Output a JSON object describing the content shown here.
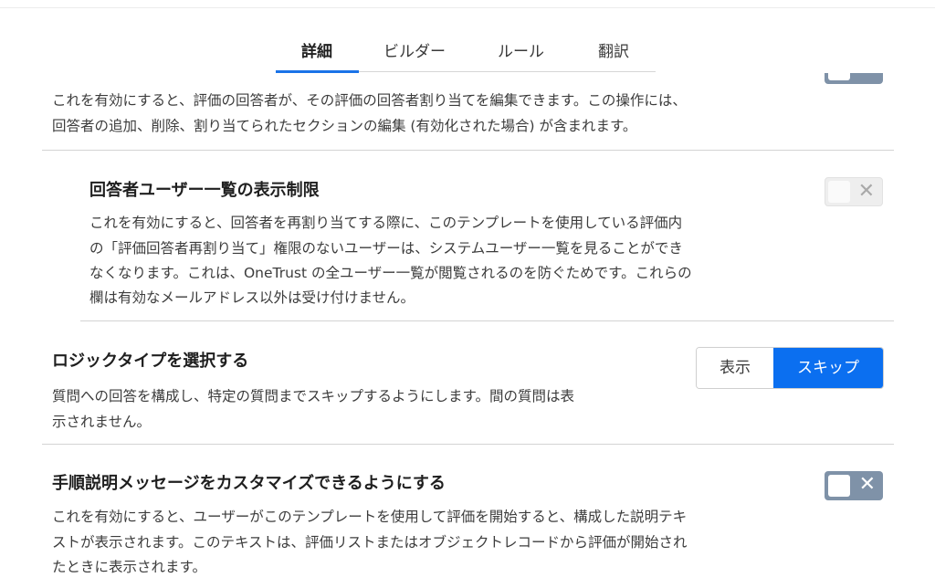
{
  "tabs": [
    {
      "label": "詳細",
      "active": true
    },
    {
      "label": "ビルダー",
      "active": false
    },
    {
      "label": "ルール",
      "active": false
    },
    {
      "label": "翻訳",
      "active": false
    }
  ],
  "sections": {
    "edit_respondents": {
      "description_line1": "これを有効にすると、評価の回答者が、その評価の回答者割り当てを編集できます。この操作には、",
      "description_line2": "回答者の追加、削除、割り当てられたセクションの編集 (有効化された場合) が含まれます。",
      "toggle_state": "off"
    },
    "restrict_user_list": {
      "title": "回答者ユーザー一覧の表示制限",
      "description_line1": "これを有効にすると、回答者を再割り当てする際に、このテンプレートを使用している評価内",
      "description_line2": "の「評価回答者再割り当て」権限のないユーザーは、システムユーザー一覧を見ることができ",
      "description_line3": "なくなります。これは、OneTrust の全ユーザー一覧が閲覧されるのを防ぐためです。これらの",
      "description_line4": "欄は有効なメールアドレス以外は受け付けません。",
      "toggle_state": "off-disabled"
    },
    "logic_type": {
      "title": "ロジックタイプを選択する",
      "description_line1": "質問への回答を構成し、特定の質問までスキップするようにします。間の質問は表",
      "description_line2": "示されません。",
      "options": [
        "表示",
        "スキップ"
      ],
      "selected": "スキップ"
    },
    "custom_instructions": {
      "title": "手順説明メッセージをカスタマイズできるようにする",
      "description_line1": "これを有効にすると、ユーザーがこのテンプレートを使用して評価を開始すると、構成した説明テキ",
      "description_line2": "ストが表示されます。このテキストは、評価リストまたはオブジェクトレコードから評価が開始され",
      "description_line3": "たときに表示されます。",
      "toggle_state": "off"
    }
  },
  "icons": {
    "toggle_off": "close-icon"
  },
  "colors": {
    "accent": "#1a73e8",
    "selected_segment": "#0b6ff0",
    "toggle_off": "#7f92a8"
  }
}
